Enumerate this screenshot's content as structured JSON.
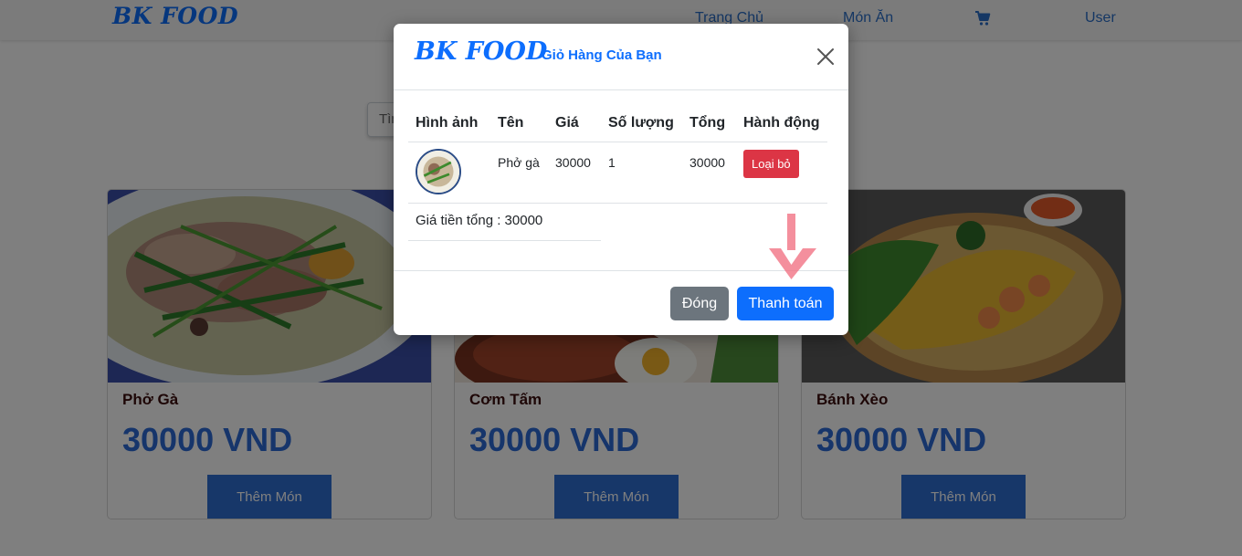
{
  "navbar": {
    "brand": "BK FOOD",
    "links": [
      "Trang Chủ",
      "Món Ăn"
    ],
    "user": "User"
  },
  "search": {
    "placeholder": "Tìm"
  },
  "cards": [
    {
      "name": "Phở Gà",
      "price": "30000 VND",
      "button": "Thêm Món"
    },
    {
      "name": "Cơm Tấm",
      "price": "30000 VND",
      "button": "Thêm Món"
    },
    {
      "name": "Bánh Xèo",
      "price": "30000 VND",
      "button": "Thêm Món"
    }
  ],
  "modal": {
    "brand": "BK FOOD",
    "title": "Giỏ Hàng Của Bạn",
    "table": {
      "headers": [
        "Hình ảnh",
        "Tên",
        "Giá",
        "Số lượng",
        "Tổng",
        "Hành động"
      ],
      "rows": [
        {
          "name": "Phở gà",
          "price": "30000",
          "quantity": "1",
          "total": "30000",
          "action": "Loại bỏ"
        }
      ]
    },
    "total_label": "Giá tiền tổng : 30000",
    "close_button": "Đóng",
    "pay_button": "Thanh toán"
  },
  "colors": {
    "primary": "#0d6efd",
    "danger": "#dc3545",
    "secondary": "#6c757d",
    "card_button": "#2f6fd3",
    "arrow": "#f06a7c"
  }
}
